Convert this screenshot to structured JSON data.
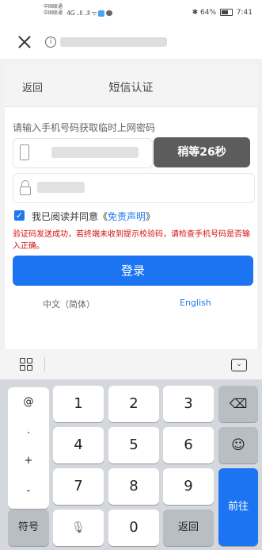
{
  "status_bar": {
    "carrier_line1": "中国联通",
    "carrier_line2": "中国联通",
    "signals": "4G ..ll ..ll ᯤ",
    "bt_icon": "bluetooth-icon",
    "battery": "64%",
    "time": "7:41"
  },
  "page": {
    "back": "返回",
    "title": "短信认证",
    "prompt": "请输入手机号码获取临时上网密码",
    "wait_button": "稍等26秒",
    "agree_prefix": "我已阅读并同意《",
    "agree_link": "免责声明",
    "agree_suffix": "》",
    "sms_message": "验证码发送成功，若终端未收到提示校验码，请检查手机号码是否输入正确。",
    "login_button": "登录",
    "lang_zh": "中文（简体）",
    "lang_en": "English"
  },
  "keyboard": {
    "symbols": [
      "@",
      ".",
      "+",
      "-"
    ],
    "digits": [
      "1",
      "2",
      "3",
      "4",
      "5",
      "6",
      "7",
      "8",
      "9",
      "0"
    ],
    "symbol_key": "符号",
    "back_key": "返回",
    "go_key": "前往",
    "backspace_icon": "backspace-icon",
    "emoji_icon": "emoji-icon",
    "mic_icon": "microphone-icon"
  },
  "colors": {
    "accent": "#1d74f2",
    "error": "#d31111",
    "wait_button": "#5c5c5c"
  }
}
